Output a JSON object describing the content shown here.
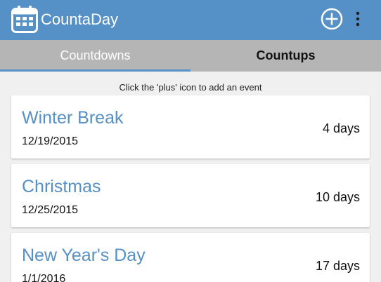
{
  "appbar": {
    "title": "CountaDay",
    "colors": {
      "primary": "#5590c6",
      "tab_bg": "#b5b5b5",
      "background": "#f0f0f0"
    },
    "icons": [
      "calendar-icon",
      "plus-circle-icon",
      "more-vert-icon"
    ]
  },
  "tabs": [
    {
      "label": "Countdowns",
      "selected": true
    },
    {
      "label": "Countups",
      "selected": false
    }
  ],
  "hint": "Click the 'plus' icon to add an event",
  "events": [
    {
      "name": "Winter Break",
      "date": "12/19/2015",
      "days": "4 days"
    },
    {
      "name": "Christmas",
      "date": "12/25/2015",
      "days": "10 days"
    },
    {
      "name": "New Year's Day",
      "date": "1/1/2016",
      "days": "17 days"
    }
  ]
}
